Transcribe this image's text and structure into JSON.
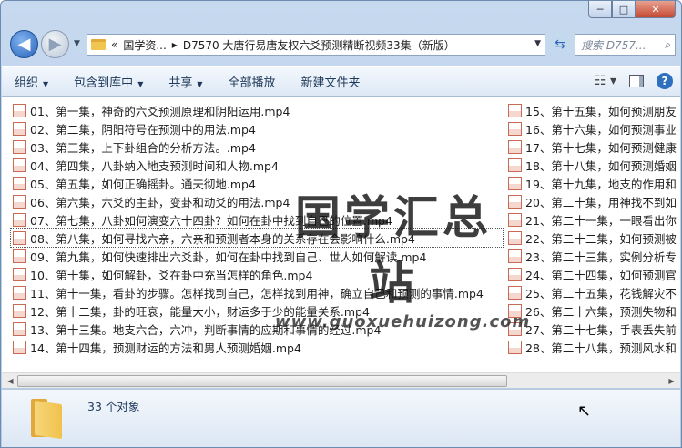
{
  "window": {
    "caption_buttons": {
      "minimize": "─",
      "maximize": "□",
      "close": "✕"
    }
  },
  "nav": {
    "back_glyph": "◀",
    "forward_glyph": "▶",
    "breadcrumb_prefix": "«",
    "breadcrumb_1": "国学资...",
    "breadcrumb_sep": "▸",
    "breadcrumb_2": "D7570 大唐行易唐友权六爻预测精断视频33集（新版）",
    "search_placeholder": "搜索 D757...",
    "search_icon": "search-icon"
  },
  "toolbar": {
    "organize": "组织",
    "include_library": "包含到库中",
    "share": "共享",
    "play_all": "全部播放",
    "new_folder": "新建文件夹"
  },
  "files_left": [
    "01、第一集，神奇的六爻预测原理和阴阳运用.mp4",
    "02、第二集，阴阳符号在预测中的用法.mp4",
    "03、第三集，上下卦组合的分析方法。.mp4",
    "04、第四集，八卦纳入地支预测时间和人物.mp4",
    "05、第五集，如何正确摇卦。通天彻地.mp4",
    "06、第六集，六爻的主卦，变卦和动爻的用法.mp4",
    "07、第七集，八卦如何演变六十四卦？如何在卦中找到自己的位置.mp4",
    "08、第八集，如何寻找六亲，六亲和预测者本身的关系存在会影响什么.mp4",
    "09、第九集，如何快速排出六爻卦，如何在卦中找到自己、世人如何解读.mp4",
    "10、第十集，如何解卦，爻在卦中充当怎样的角色.mp4",
    "11、第十一集，看卦的步骤。怎样找到自己，怎样找到用神，确立自己和预测的事情.mp4",
    "12、第十二集，卦的旺衰，能量大小，财运多于少的能量关系.mp4",
    "13、第十三集。地支六合，六冲，判断事情的应期和事情的经过.mp4",
    "14、第十四集，预测财运的方法和男人预测婚姻.mp4"
  ],
  "files_right": [
    "15、第十五集，如何预测朋友",
    "16、第十六集，如何预测事业",
    "17、第十七集，如何预测健康",
    "18、第十八集，如何预测婚姻",
    "19、第十九集，地支的作用和",
    "20、第二十集，用神找不到如",
    "21、第二十一集，一眼看出你",
    "22、第二十二集，如何预测被",
    "23、第二十三集，实例分析专",
    "24、第二十四集，如何预测官",
    "25、第二十五集，花钱解灾不",
    "26、第二十六集，预测失物和",
    "27、第二十七集，手表丢失前",
    "28、第二十八集，预测风水和"
  ],
  "watermark": {
    "text": "国学汇总站",
    "url": "www.guoxuehuizong.com"
  },
  "status": {
    "count": "33 个对象"
  }
}
